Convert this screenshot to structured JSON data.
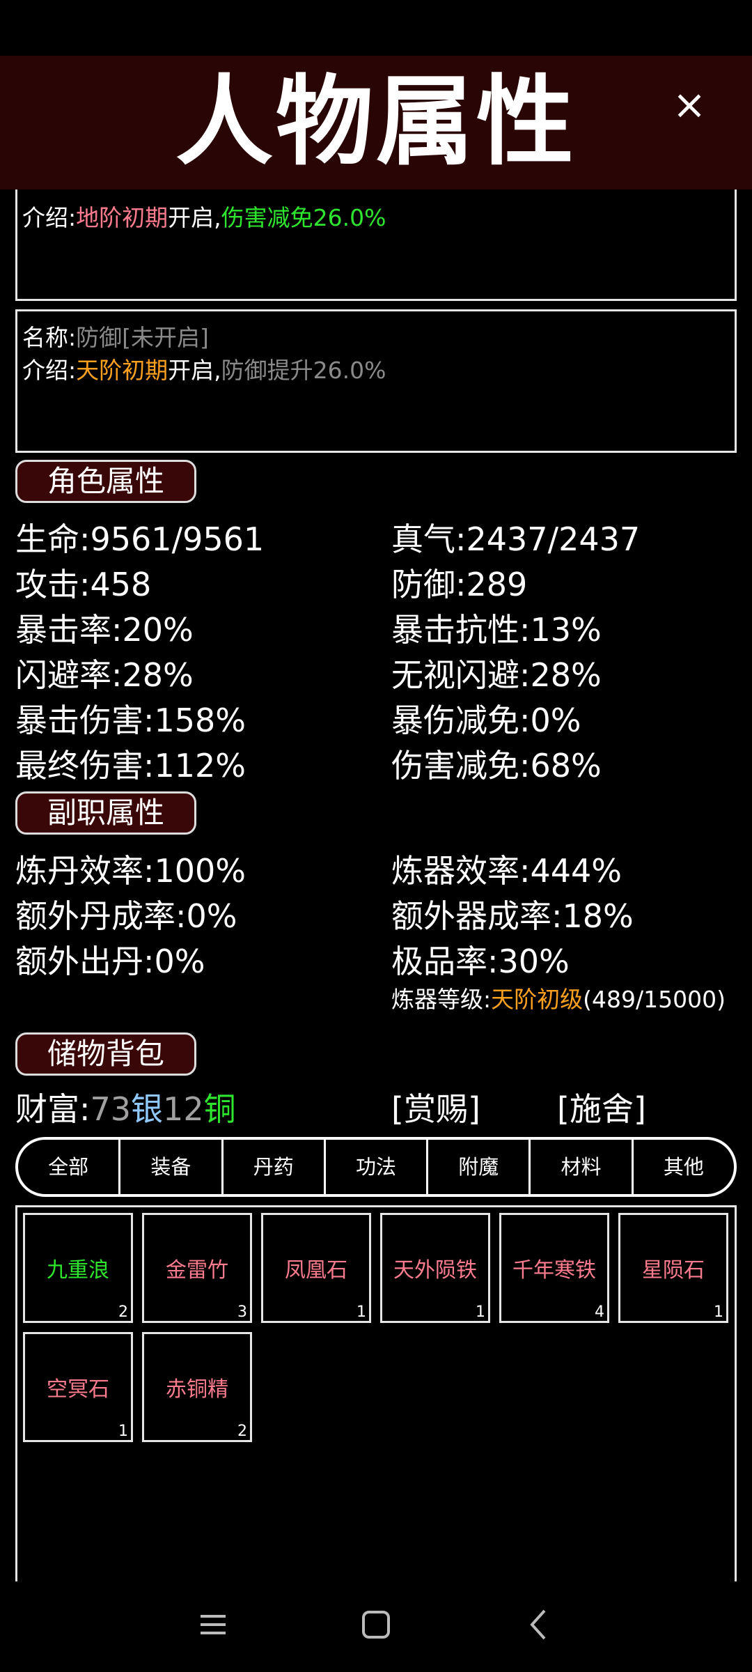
{
  "header": {
    "title": "人物属性",
    "close_label": "×"
  },
  "skills": [
    {
      "intro_label": "介绍:",
      "cond": "地阶初期",
      "open": "开启,",
      "effect": "伤害减免26.0%"
    },
    {
      "name_label": "名称:",
      "name": "防御[未开启]",
      "intro_label": "介绍:",
      "cond": "天阶初期",
      "open": "开启,",
      "effect": "防御提升26.0%"
    }
  ],
  "role": {
    "title": "角色属性",
    "left": [
      {
        "label": "生命:",
        "value": "9561/9561"
      },
      {
        "label": "攻击:",
        "value": "458"
      },
      {
        "label": "暴击率:",
        "value": "20%"
      },
      {
        "label": "闪避率:",
        "value": "28%"
      },
      {
        "label": "暴击伤害:",
        "value": "158%"
      },
      {
        "label": "最终伤害:",
        "value": "112%"
      }
    ],
    "right": [
      {
        "label": "真气:",
        "value": "2437/2437"
      },
      {
        "label": "防御:",
        "value": "289"
      },
      {
        "label": "暴击抗性:",
        "value": "13%"
      },
      {
        "label": "无视闪避:",
        "value": "28%"
      },
      {
        "label": "暴伤减免:",
        "value": "0%"
      },
      {
        "label": "伤害减免:",
        "value": "68%"
      }
    ]
  },
  "sub": {
    "title": "副职属性",
    "left": [
      {
        "label": "炼丹效率:",
        "value": "100%"
      },
      {
        "label": "额外丹成率:",
        "value": "0%"
      },
      {
        "label": "额外出丹:",
        "value": "0%"
      }
    ],
    "right": [
      {
        "label": "炼器效率:",
        "value": "444%"
      },
      {
        "label": "额外器成率:",
        "value": "18%"
      },
      {
        "label": "极品率:",
        "value": "30%"
      }
    ],
    "forge_level": {
      "label": "炼器等级:",
      "rank": "天阶初级",
      "progress": "(489/15000)"
    }
  },
  "bag": {
    "title": "储物背包",
    "wealth_label": "财富:",
    "silver": "73",
    "silver_unit": "银",
    "copper": "12",
    "copper_unit": "铜",
    "reward_label": "[赏赐]",
    "give_label": "[施舍]",
    "tabs": [
      "全部",
      "装备",
      "丹药",
      "功法",
      "附魔",
      "材料",
      "其他"
    ],
    "items": [
      {
        "name": "九重浪",
        "count": "2",
        "color": "#2ee62e"
      },
      {
        "name": "金雷竹",
        "count": "3",
        "color": "#ff7b8e"
      },
      {
        "name": "凤凰石",
        "count": "1",
        "color": "#ff7b8e"
      },
      {
        "name": "天外陨铁",
        "count": "1",
        "color": "#ff7b8e"
      },
      {
        "name": "千年寒铁",
        "count": "4",
        "color": "#ff7b8e"
      },
      {
        "name": "星陨石",
        "count": "1",
        "color": "#ff7b8e"
      },
      {
        "name": "空冥石",
        "count": "1",
        "color": "#ff7b8e"
      },
      {
        "name": "赤铜精",
        "count": "2",
        "color": "#ff7b8e"
      }
    ]
  },
  "navbar": {
    "icons": [
      "menu-icon",
      "home-icon",
      "back-icon"
    ]
  }
}
